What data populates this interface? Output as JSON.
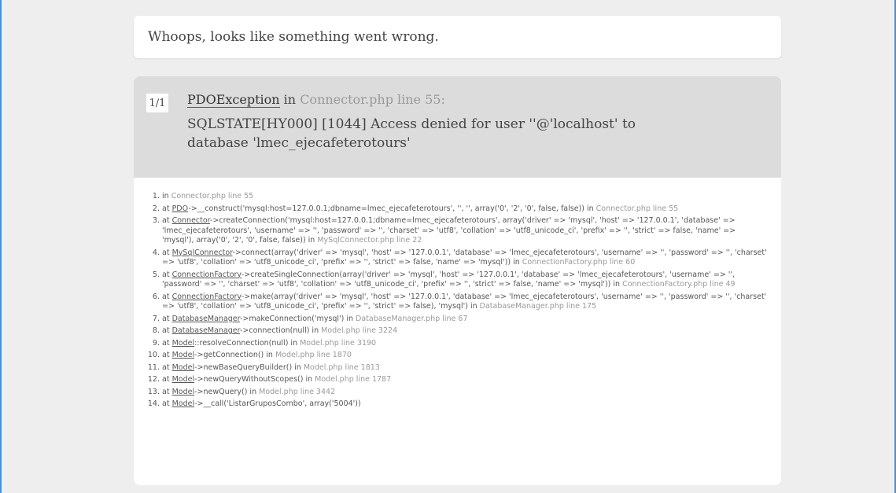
{
  "header": {
    "title": "Whoops, looks like something went wrong."
  },
  "exception": {
    "counter": "1/1",
    "class": "PDOException",
    "in_label": "in",
    "file_line": "Connector.php line 55:",
    "message": "SQLSTATE[HY000] [1044] Access denied for user ''@'localhost' to database 'lmec_ejecafeterotours'"
  },
  "trace": [
    {
      "prefix": "in ",
      "cls": "",
      "call": "",
      "loc": "Connector.php line 55"
    },
    {
      "prefix": "at ",
      "cls": "PDO",
      "call": "->__construct('mysql:host=127.0.0.1;dbname=lmec_ejecafeterotours', '', '', array('0', '2', '0', false, false)) in ",
      "loc": "Connector.php line 55"
    },
    {
      "prefix": "at ",
      "cls": "Connector",
      "call": "->createConnection('mysql:host=127.0.0.1;dbname=lmec_ejecafeterotours', array('driver' => 'mysql', 'host' => '127.0.0.1', 'database' => 'lmec_ejecafeterotours', 'username' => '', 'password' => '', 'charset' => 'utf8', 'collation' => 'utf8_unicode_ci', 'prefix' => '', 'strict' => false, 'name' => 'mysql'), array('0', '2', '0', false, false)) in ",
      "loc": "MySqlConnector.php line 22"
    },
    {
      "prefix": "at ",
      "cls": "MySqlConnector",
      "call": "->connect(array('driver' => 'mysql', 'host' => '127.0.0.1', 'database' => 'lmec_ejecafeterotours', 'username' => '', 'password' => '', 'charset' => 'utf8', 'collation' => 'utf8_unicode_ci', 'prefix' => '', 'strict' => false, 'name' => 'mysql')) in ",
      "loc": "ConnectionFactory.php line 60"
    },
    {
      "prefix": "at ",
      "cls": "ConnectionFactory",
      "call": "->createSingleConnection(array('driver' => 'mysql', 'host' => '127.0.0.1', 'database' => 'lmec_ejecafeterotours', 'username' => '', 'password' => '', 'charset' => 'utf8', 'collation' => 'utf8_unicode_ci', 'prefix' => '', 'strict' => false, 'name' => 'mysql')) in ",
      "loc": "ConnectionFactory.php line 49"
    },
    {
      "prefix": "at ",
      "cls": "ConnectionFactory",
      "call": "->make(array('driver' => 'mysql', 'host' => '127.0.0.1', 'database' => 'lmec_ejecafeterotours', 'username' => '', 'password' => '', 'charset' => 'utf8', 'collation' => 'utf8_unicode_ci', 'prefix' => '', 'strict' => false), 'mysql') in ",
      "loc": "DatabaseManager.php line 175"
    },
    {
      "prefix": "at ",
      "cls": "DatabaseManager",
      "call": "->makeConnection('mysql') in ",
      "loc": "DatabaseManager.php line 67"
    },
    {
      "prefix": "at ",
      "cls": "DatabaseManager",
      "call": "->connection(null) in ",
      "loc": "Model.php line 3224"
    },
    {
      "prefix": "at ",
      "cls": "Model",
      "call": "::resolveConnection(null) in ",
      "loc": "Model.php line 3190"
    },
    {
      "prefix": "at ",
      "cls": "Model",
      "call": "->getConnection() in ",
      "loc": "Model.php line 1870"
    },
    {
      "prefix": "at ",
      "cls": "Model",
      "call": "->newBaseQueryBuilder() in ",
      "loc": "Model.php line 1813"
    },
    {
      "prefix": "at ",
      "cls": "Model",
      "call": "->newQueryWithoutScopes() in ",
      "loc": "Model.php line 1787"
    },
    {
      "prefix": "at ",
      "cls": "Model",
      "call": "->newQuery() in ",
      "loc": "Model.php line 3442"
    },
    {
      "prefix": "at ",
      "cls": "Model",
      "call": "->__call('ListarGruposCombo', array('5004'))",
      "loc": ""
    }
  ]
}
